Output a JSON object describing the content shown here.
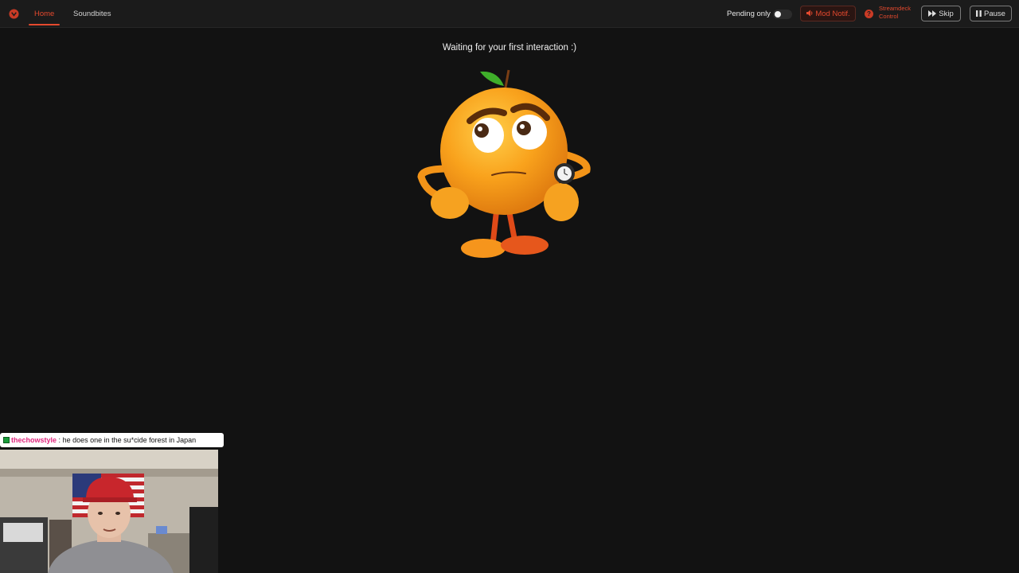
{
  "nav": {
    "logo_icon": "app-logo-icon",
    "tabs": [
      {
        "label": "Home",
        "active": true
      },
      {
        "label": "Soundbites",
        "active": false
      }
    ]
  },
  "controls": {
    "pending_label": "Pending only",
    "pending_enabled": false,
    "mod_notif_label": "Mod Notif.",
    "mod_notif_icon": "speaker-icon",
    "streamdeck_label_line1": "Streamdeck",
    "streamdeck_label_line2": "Control",
    "streamdeck_icon": "streamdeck-icon",
    "skip_label": "Skip",
    "skip_icon": "fast-forward-icon",
    "pause_label": "Pause",
    "pause_icon": "pause-icon"
  },
  "main": {
    "status_text": "Waiting for your first interaction :)",
    "mascot_icon": "orange-mascot-checking-watch"
  },
  "chat": {
    "badge_icon": "moderator-badge-icon",
    "username": "thechowstyle",
    "separator": ":",
    "message": "he does one in the su*cide forest in Japan"
  },
  "colors": {
    "accent": "#e4492e",
    "background": "#121212",
    "topbar": "#1b1b1b",
    "chat_username": "#e0287e"
  }
}
